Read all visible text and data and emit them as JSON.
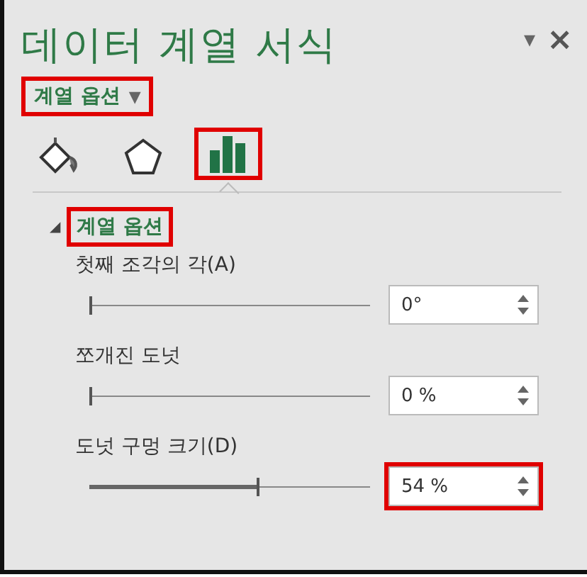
{
  "pane": {
    "title": "데이터 계열 서식",
    "menu_caret": "▾",
    "close": "×"
  },
  "options_dropdown": {
    "label": "계열 옵션",
    "caret": "▼",
    "highlighted": true
  },
  "icon_tabs": [
    {
      "kind": "fill",
      "selected": false,
      "highlighted": false
    },
    {
      "kind": "shape",
      "selected": false,
      "highlighted": false
    },
    {
      "kind": "chart",
      "selected": true,
      "highlighted": true
    }
  ],
  "section": {
    "toggle": "◢",
    "title": "계열 옵션",
    "expanded": true,
    "highlighted": true
  },
  "settings": [
    {
      "label": "첫째 조각의 각(A)",
      "level": 0,
      "value": "0°",
      "highlighted": false
    },
    {
      "label": "쪼개진 도넛",
      "level": 0,
      "value": "0 %",
      "highlighted": false
    },
    {
      "label": "도넛 구멍 크기(D)",
      "level": 0.6,
      "value": "54 %",
      "highlighted": true
    }
  ]
}
